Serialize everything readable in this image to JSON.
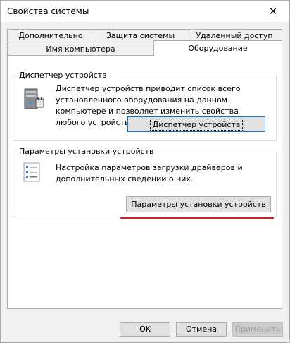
{
  "window": {
    "title": "Свойства системы",
    "close_glyph": "✕"
  },
  "tabs": {
    "row1": [
      "Дополнительно",
      "Защита системы",
      "Удаленный доступ"
    ],
    "row2": [
      "Имя компьютера",
      "Оборудование"
    ],
    "active": "Оборудование"
  },
  "device_manager": {
    "group_label": "Диспетчер устройств",
    "description": "Диспетчер устройств приводит список всего установленного оборудования на данном компьютере и позволяет изменить свойства любого устройства.",
    "button_label": "Диспетчер устройств"
  },
  "install_settings": {
    "group_label": "Параметры установки устройств",
    "description": "Настройка параметров загрузки драйверов и дополнительных сведений о них.",
    "button_label": "Параметры установки устройств"
  },
  "footer": {
    "ok_label": "OK",
    "cancel_label": "Отмена",
    "apply_label": "Применить"
  },
  "colors": {
    "annotation_underline": "#d92020",
    "focus_border": "#0078d7"
  }
}
